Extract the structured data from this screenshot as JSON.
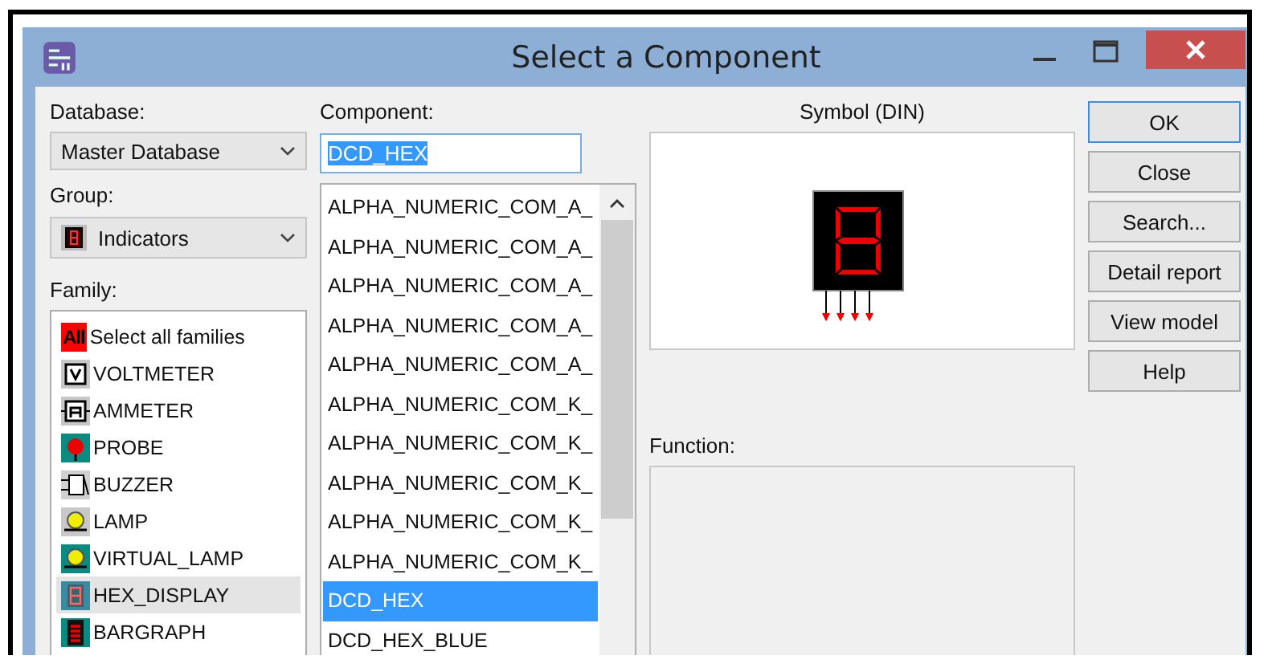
{
  "window": {
    "title": "Select a Component"
  },
  "database": {
    "label": "Database:",
    "value": "Master Database"
  },
  "group": {
    "label": "Group:",
    "value": "Indicators"
  },
  "family": {
    "label": "Family:",
    "items": [
      {
        "label": "Select all families",
        "kind": "all",
        "icon_label": "All",
        "selected": false
      },
      {
        "label": "VOLTMETER",
        "kind": "voltmeter",
        "selected": false
      },
      {
        "label": "AMMETER",
        "kind": "ammeter",
        "selected": false
      },
      {
        "label": "PROBE",
        "kind": "probe",
        "selected": false
      },
      {
        "label": "BUZZER",
        "kind": "buzzer",
        "selected": false
      },
      {
        "label": "LAMP",
        "kind": "lamp",
        "selected": false
      },
      {
        "label": "VIRTUAL_LAMP",
        "kind": "virtual_lamp",
        "selected": false
      },
      {
        "label": "HEX_DISPLAY",
        "kind": "hex_display",
        "selected": true
      },
      {
        "label": "BARGRAPH",
        "kind": "bargraph",
        "selected": false
      }
    ]
  },
  "component": {
    "label": "Component:",
    "value": "DCD_HEX",
    "items": [
      {
        "label": "ALPHA_NUMERIC_COM_A_",
        "selected": false
      },
      {
        "label": "ALPHA_NUMERIC_COM_A_",
        "selected": false
      },
      {
        "label": "ALPHA_NUMERIC_COM_A_",
        "selected": false
      },
      {
        "label": "ALPHA_NUMERIC_COM_A_",
        "selected": false
      },
      {
        "label": "ALPHA_NUMERIC_COM_A_",
        "selected": false
      },
      {
        "label": "ALPHA_NUMERIC_COM_K_",
        "selected": false
      },
      {
        "label": "ALPHA_NUMERIC_COM_K_",
        "selected": false
      },
      {
        "label": "ALPHA_NUMERIC_COM_K_",
        "selected": false
      },
      {
        "label": "ALPHA_NUMERIC_COM_K_",
        "selected": false
      },
      {
        "label": "ALPHA_NUMERIC_COM_K_",
        "selected": false
      },
      {
        "label": "DCD_HEX",
        "selected": true
      },
      {
        "label": "DCD_HEX_BLUE",
        "selected": false
      }
    ]
  },
  "symbol": {
    "label": "Symbol (DIN)"
  },
  "function": {
    "label": "Function:"
  },
  "buttons": [
    {
      "label": "OK",
      "default": true
    },
    {
      "label": "Close",
      "default": false
    },
    {
      "label": "Search...",
      "default": false
    },
    {
      "label": "Detail report",
      "default": false
    },
    {
      "label": "View model",
      "default": false
    },
    {
      "label": "Help",
      "default": false
    }
  ]
}
